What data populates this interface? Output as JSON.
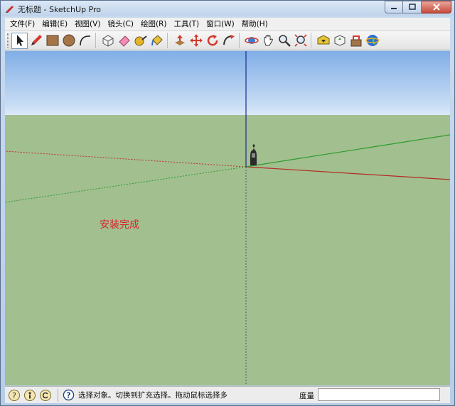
{
  "window": {
    "title": "无标题 - SketchUp Pro"
  },
  "menu": [
    "文件(F)",
    "编辑(E)",
    "视图(V)",
    "镜头(C)",
    "绘图(R)",
    "工具(T)",
    "窗口(W)",
    "帮助(H)"
  ],
  "toolbar": {
    "icons": [
      "select-icon",
      "pencil-icon",
      "rectangle-icon",
      "circle-icon",
      "arc-icon",
      "make-component-icon",
      "eraser-icon",
      "tape-measure-icon",
      "paint-bucket-icon",
      "push-pull-icon",
      "move-icon",
      "rotate-icon",
      "follow-me-icon",
      "orbit-icon",
      "pan-icon",
      "zoom-icon",
      "zoom-extents-icon",
      "3d-warehouse-icon",
      "share-model-icon",
      "extension-warehouse-icon",
      "google-earth-icon"
    ]
  },
  "viewport": {
    "message": "安装完成"
  },
  "status": {
    "text": "选择对象。切换到扩充选择。拖动鼠标选择多",
    "measure_label": "度量",
    "measure_value": ""
  },
  "colors": {
    "red_axis": "#c0302a",
    "green_axis": "#2f9b2f",
    "blue_axis": "#1d2c8f",
    "ground": "#a1bf8f",
    "message": "#d6262b"
  }
}
